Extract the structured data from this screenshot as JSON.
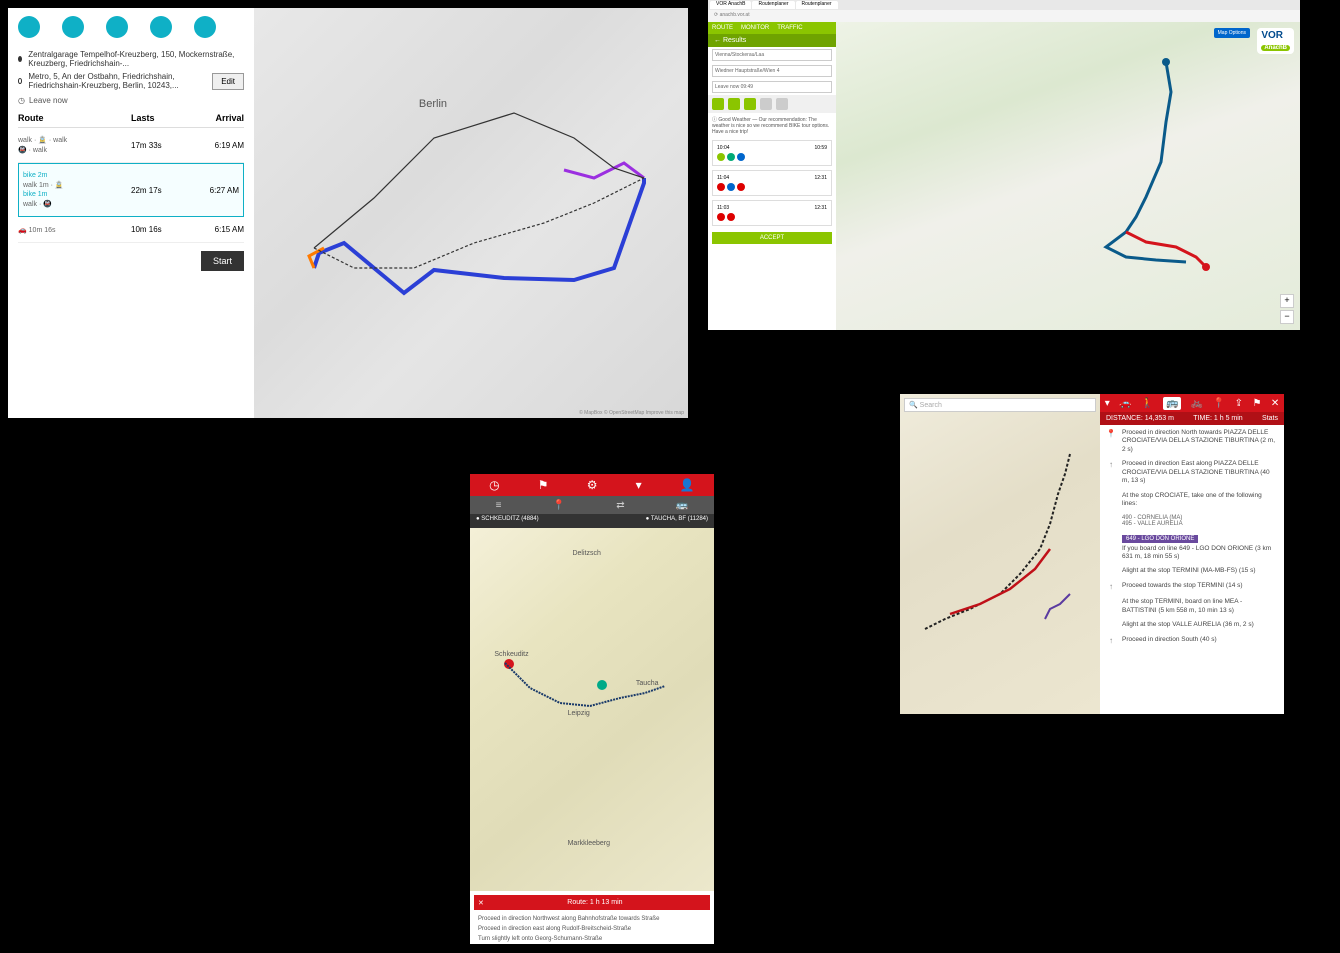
{
  "p1": {
    "origin": "Zentralgarage Tempelhof-Kreuzberg, 150, Mockernstraße, Kreuzberg, Friedrichshain-...",
    "dest": "Metro, 5, An der Ostbahn, Friedrichshain, Friedrichshain-Kreuzberg, Berlin, 10243,...",
    "edit": "Edit",
    "leave": "Leave now",
    "hdr_route": "Route",
    "hdr_lasts": "Lasts",
    "hdr_arrival": "Arrival",
    "r1_dur": "17m 33s",
    "r1_arr": "6:19 AM",
    "r2_dur": "22m 17s",
    "r2_arr": "6:27 AM",
    "r3_dur": "10m 16s",
    "r3_arr": "6:15 AM",
    "start": "Start",
    "city": "Berlin",
    "attrib": "© MapBox © OpenStreetMap Improve this map"
  },
  "p2": {
    "tab_route": "ROUTE",
    "tab_mon": "MONITOR",
    "tab_traf": "TRAFFIC",
    "results": "Results",
    "from": "Vienna/Stockerau/Laa",
    "to": "Wiedner Hauptstraße/Wien 4",
    "leave": "Leave now 09:49",
    "opt1_t": "10:04",
    "opt1_a": "10:59",
    "opt2_t": "11:04",
    "opt2_a": "12:31",
    "opt3_t": "11:03",
    "opt3_a": "12:31",
    "accept": "ACCEPT",
    "logo": "VOR",
    "logo_sub": "AnachB",
    "mapopt": "Map Options"
  },
  "p3": {
    "from": "SCHKEUDITZ (4884)",
    "to": "TAUCHA, BF (11284)",
    "btn": "Route: 1 h 13 min",
    "s1": "Proceed in direction Northwest along Bahnhofstraße towards Straße",
    "s2": "Proceed in direction east along Rudolf-Breitscheid-Straße",
    "s3": "Turn slightly left onto Georg-Schumann-Straße"
  },
  "p4": {
    "search": "Search",
    "dist": "DISTANCE: 14,353 m",
    "time": "TIME: 1 h 5 min",
    "stats": "Stats",
    "s1": "Proceed in direction North towards PIAZZA DELLE CROCIATE/VIA DELLA STAZIONE TIBURTINA (2 m, 2 s)",
    "s2": "Proceed in direction East along PIAZZA DELLE CROCIATE/VIA DELLA STAZIONE TIBURTINA (40 m, 13 s)",
    "s3": "At the stop CROCIATE, take one of the following lines:",
    "l1": "490 - CORNELIA (MA)",
    "l2": "495 - VALLE AURELIA",
    "l3": "649 - LGO DON ORIONE",
    "s4": "If you board on line 649 - LGO DON ORIONE (3 km 631 m, 18 min 55 s)",
    "s5": "Alight at the stop TERMINI (MA-MB-FS) (15 s)",
    "s6": "Proceed towards the stop TERMINI (14 s)",
    "s7": "At the stop TERMINI, board on line MEA - BATTISTINI (5 km 558 m, 10 min 13 s)",
    "s8": "Alight at the stop VALLE AURELIA (36 m, 2 s)",
    "s9": "Proceed in direction South (40 s)"
  }
}
